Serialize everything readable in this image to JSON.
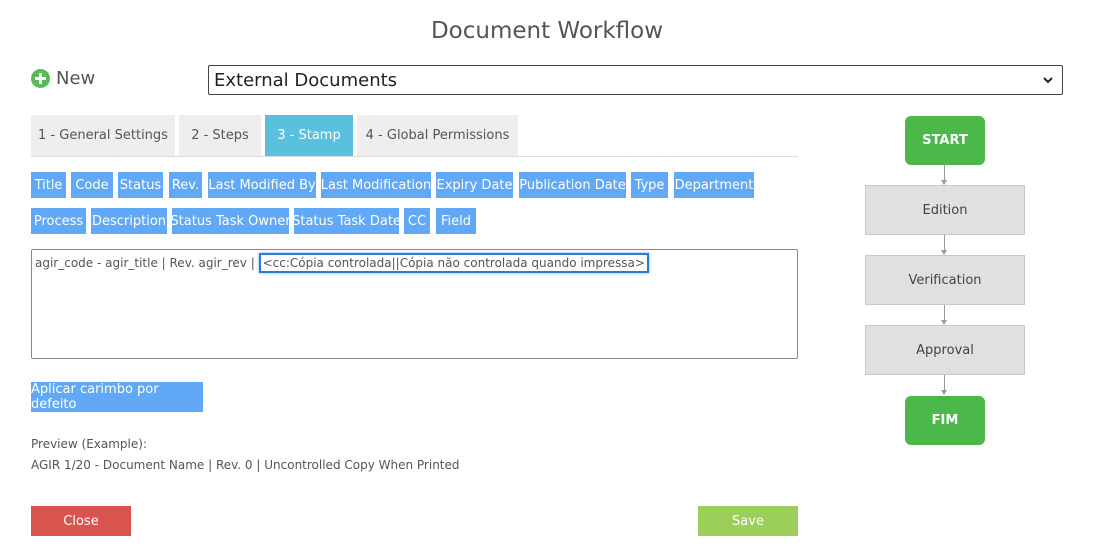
{
  "page": {
    "title": "Document Workflow"
  },
  "new": {
    "label": "New"
  },
  "workflow_select": {
    "selected": "External Documents"
  },
  "tabs": [
    {
      "label": "1 - General Settings"
    },
    {
      "label": "2 - Steps"
    },
    {
      "label": "3 - Stamp"
    },
    {
      "label": "4 - Global Permissions"
    }
  ],
  "field_buttons": [
    {
      "label": "Title"
    },
    {
      "label": "Code"
    },
    {
      "label": "Status"
    },
    {
      "label": "Rev."
    },
    {
      "label": "Last Modified By"
    },
    {
      "label": "Last Modification"
    },
    {
      "label": "Expiry Date"
    },
    {
      "label": "Publication Date"
    },
    {
      "label": "Type"
    },
    {
      "label": "Department"
    },
    {
      "label": "Process"
    },
    {
      "label": "Description"
    },
    {
      "label": "Status Task Owner"
    },
    {
      "label": "Status Task Date"
    },
    {
      "label": "CC"
    },
    {
      "label": "Field"
    }
  ],
  "stamp": {
    "text_plain": "agir_code - agir_title | Rev. agir_rev | ",
    "text_selected": "<cc:Cópia controlada||Cópia não controlada quando impressa>"
  },
  "default_button": {
    "label": "Aplicar carimbo por defeito"
  },
  "preview": {
    "label": "Preview (Example):",
    "value": "AGIR 1/20 - Document Name | Rev. 0 | Uncontrolled Copy When Printed"
  },
  "actions": {
    "close": "Close",
    "save": "Save"
  },
  "workflow": {
    "start": "START",
    "steps": [
      {
        "label": "Edition"
      },
      {
        "label": "Verification"
      },
      {
        "label": "Approval"
      }
    ],
    "end": "FIM"
  },
  "colors": {
    "tab_active": "#5bc0de",
    "field_button": "#61a9f6",
    "close": "#d9534f",
    "save": "#9ccf5a",
    "terminal": "#4cb84c",
    "highlight": "#2a7bd6"
  }
}
